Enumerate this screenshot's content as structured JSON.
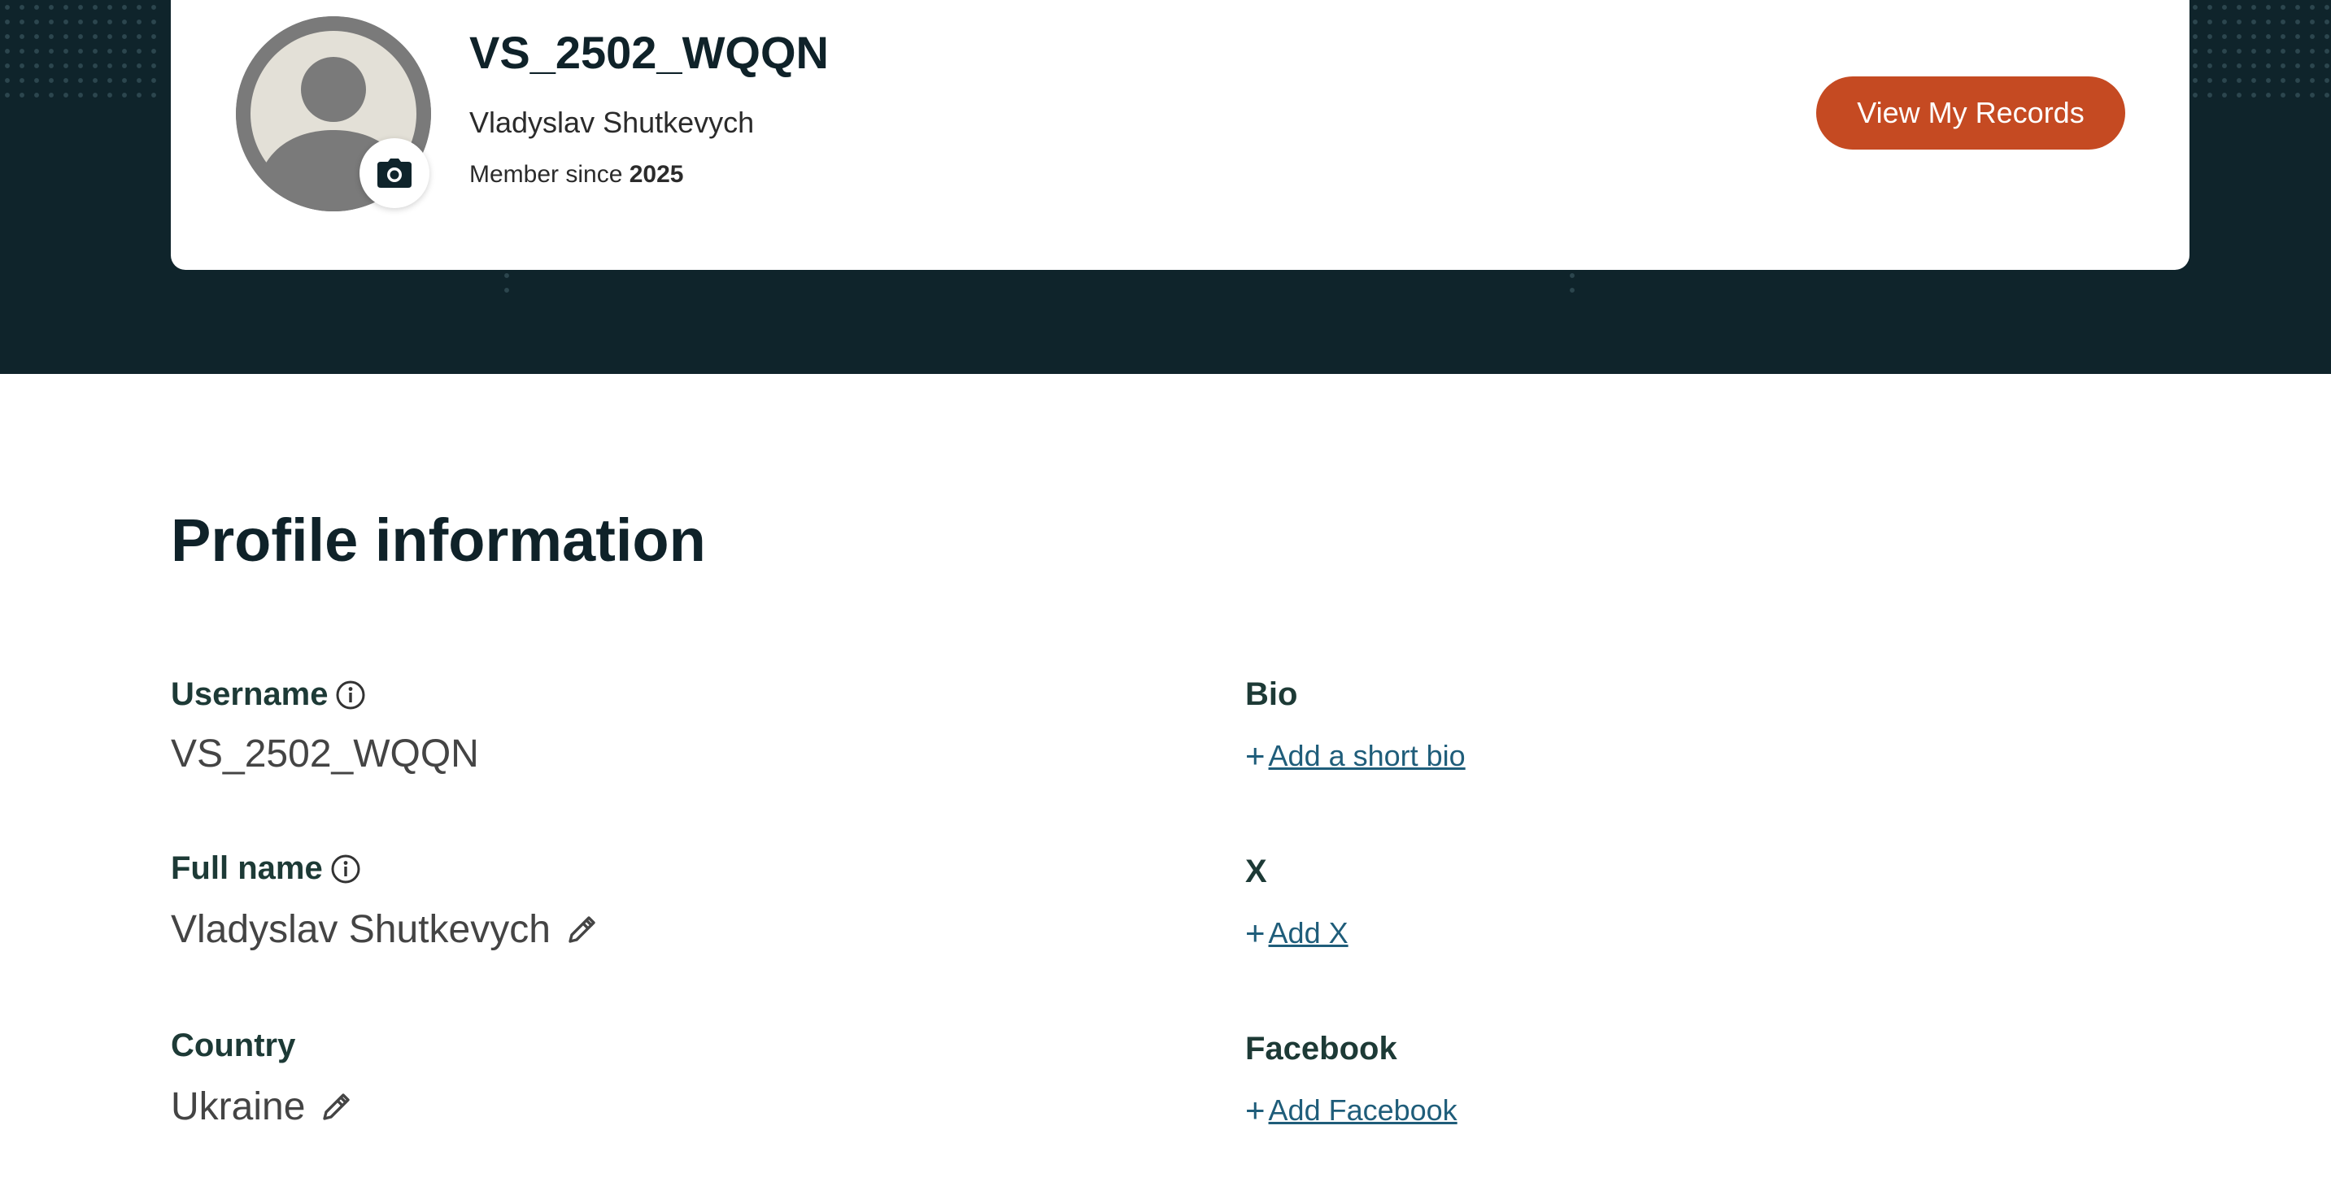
{
  "profile": {
    "username": "VS_2502_WQQN",
    "full_name": "Vladyslav Shutkevych",
    "member_since_label": "Member since",
    "member_since_year": "2025",
    "view_records_label": "View My Records"
  },
  "profile_info": {
    "title": "Profile information",
    "username_label": "Username",
    "username_value": "VS_2502_WQQN",
    "full_name_label": "Full name",
    "full_name_value": "Vladyslav Shutkevych",
    "country_label": "Country",
    "country_value": "Ukraine",
    "bio_label": "Bio",
    "bio_add": "Add a short bio",
    "x_label": "X",
    "x_add": "Add X",
    "facebook_label": "Facebook",
    "facebook_add": "Add Facebook"
  },
  "colors": {
    "hero_background": "#0f242b",
    "accent_button": "#c54a22",
    "link": "#1f5d7a",
    "label": "#1d3a36"
  },
  "icons": [
    "camera-icon",
    "info-icon",
    "pencil-icon",
    "plus-icon",
    "avatar-placeholder-icon"
  ]
}
